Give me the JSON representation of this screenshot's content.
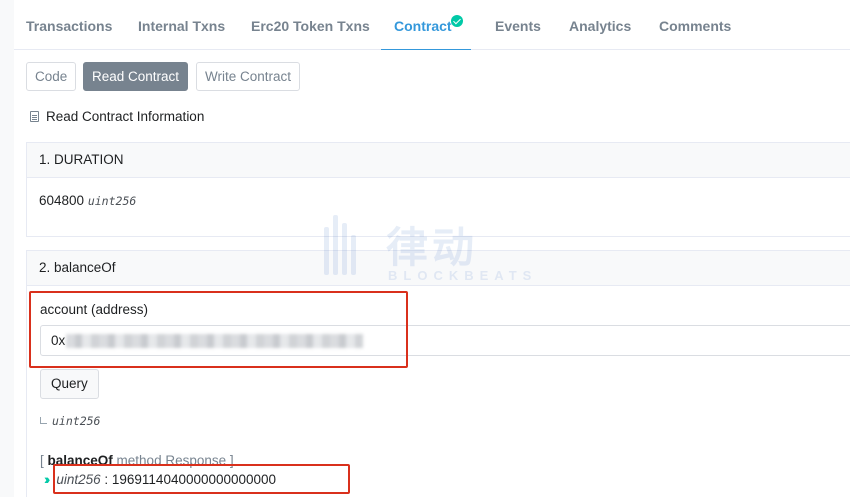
{
  "tabs": [
    {
      "label": "Transactions"
    },
    {
      "label": "Internal Txns"
    },
    {
      "label": "Erc20 Token Txns"
    },
    {
      "label": "Contract",
      "verified": true
    },
    {
      "label": "Events"
    },
    {
      "label": "Analytics"
    },
    {
      "label": "Comments"
    }
  ],
  "subtabs": {
    "code": "Code",
    "read": "Read Contract",
    "write": "Write Contract"
  },
  "info_title": "Read Contract Information",
  "functions": {
    "duration": {
      "title": "1. DURATION",
      "value": "604800",
      "type": "uint256"
    },
    "balance_of": {
      "title": "2. balanceOf",
      "param_label": "account (address)",
      "input_value": "0x",
      "query_label": "Query",
      "return_type": "uint256",
      "response_prefix": "[ ",
      "response_name": "balanceOf",
      "response_suffix": " method Response ]",
      "response_type": "uint256",
      "response_sep": " : ",
      "response_value": "1969114040000000000000"
    }
  },
  "watermark": {
    "cn": "律动",
    "en": "BLOCKBEATS"
  },
  "colors": {
    "accent": "#3498db",
    "verified": "#00c9a7",
    "highlight": "#d9301c"
  }
}
